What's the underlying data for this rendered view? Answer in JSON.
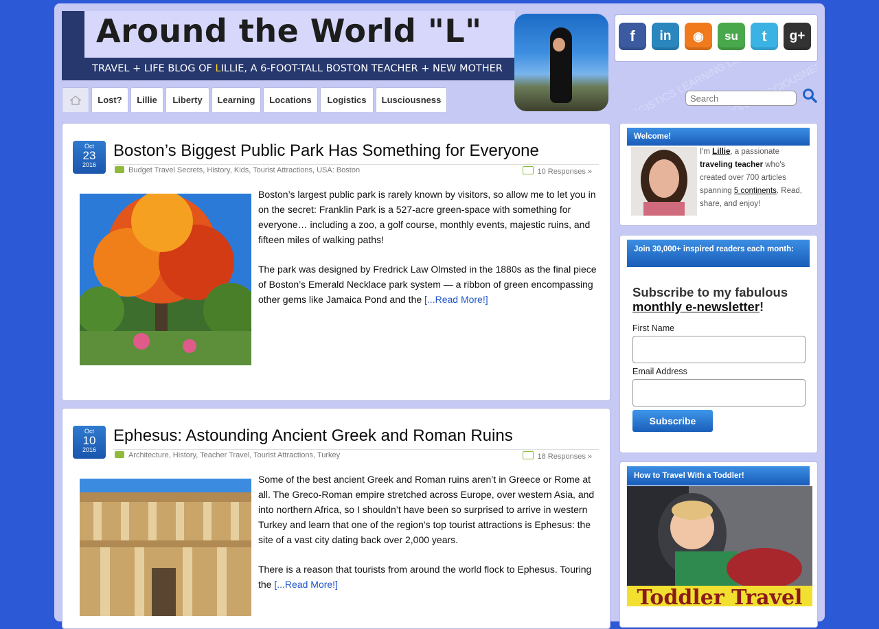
{
  "header": {
    "title": "Around the World \"L\"",
    "tagline_pre": "TRAVEL + LIFE BLOG OF ",
    "tagline_accent": "L",
    "tagline_post": "ILLIE, A 6-FOOT-TALL BOSTON TEACHER + NEW MOTHER"
  },
  "social": [
    {
      "name": "facebook",
      "glyph": "f",
      "color": "#3b5aa0"
    },
    {
      "name": "linkedin",
      "glyph": "in",
      "color": "#2b86bd"
    },
    {
      "name": "rss",
      "glyph": "◉",
      "color": "#f07a1c"
    },
    {
      "name": "stumbleupon",
      "glyph": "su",
      "color": "#4aa84c"
    },
    {
      "name": "twitter",
      "glyph": "t",
      "color": "#3bb2e4"
    },
    {
      "name": "googleplus",
      "glyph": "g+",
      "color": "#333333"
    }
  ],
  "nav": {
    "items": [
      "Lost?",
      "Lillie",
      "Liberty",
      "Learning",
      "Locations",
      "Logistics",
      "Lusciousness"
    ]
  },
  "search": {
    "placeholder": "Search"
  },
  "posts": [
    {
      "month": "Oct",
      "day": "23",
      "year": "2016",
      "title": "Boston’s Biggest Public Park Has Something for Everyone",
      "categories": "Budget Travel Secrets, History, Kids, Tourist Attractions, USA: Boston",
      "responses": "10 Responses »",
      "p1": "Boston’s largest public park is rarely known by visitors, so allow me to let you in on the secret: Franklin Park is a 527-acre green-space with something for everyone… including a zoo, a golf course, monthly events, majestic ruins, and fifteen miles of walking paths!",
      "p2": "The park was designed by Fredrick Law Olmsted in the 1880s as the final piece of Boston’s Emerald Necklace park system — a ribbon of green encompassing other gems like Jamaica Pond and the ",
      "read_more": "[...Read More!]"
    },
    {
      "month": "Oct",
      "day": "10",
      "year": "2016",
      "title": "Ephesus: Astounding Ancient Greek and Roman Ruins",
      "categories": "Architecture, History, Teacher Travel, Tourist Attractions, Turkey",
      "responses": "18 Responses »",
      "p1": "Some of the best ancient Greek and Roman ruins aren’t in Greece or Rome at all. The Greco-Roman empire stretched across Europe, over western Asia, and into northern Africa, so I shouldn’t have been so surprised to arrive in western Turkey and learn that one of the region’s top tourist attractions is Ephesus: the site of a vast city dating back over 2,000 years.",
      "p2": "There is a reason that tourists from around the world flock to Ephesus. Touring the ",
      "read_more": "[...Read More!]"
    }
  ],
  "sidebar": {
    "welcome": {
      "heading": "Welcome!",
      "im": "I'm ",
      "name": "Lillie",
      "t1": ", a passionate ",
      "role": "traveling teacher",
      "t2": " who's created over 700 articles spanning ",
      "continents": "5 continents",
      "t3": ". Read, share, and enjoy!"
    },
    "newsletter": {
      "heading": "Join 30,000+ inspired readers each month:",
      "title_pre": "Subscribe to my fabulous ",
      "title_link": "monthly e-newsletter",
      "title_post": "!",
      "first_name_label": "First Name",
      "email_label": "Email Address",
      "button": "Subscribe"
    },
    "toddler": {
      "heading": "How to Travel With a Toddler!",
      "banner_text": "Toddler Travel"
    }
  }
}
